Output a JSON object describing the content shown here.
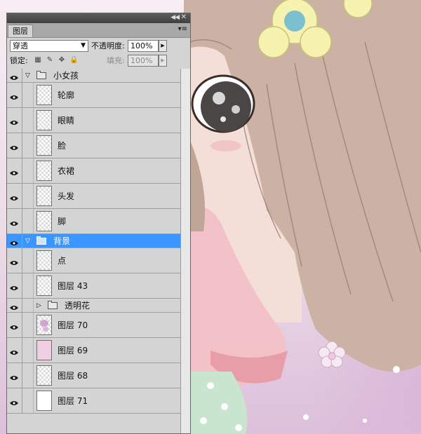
{
  "panel": {
    "tab_label": "图层",
    "blend_mode": "穿透",
    "opacity_label": "不透明度:",
    "opacity_value": "100%",
    "lock_label": "锁定:",
    "fill_label": "填充:",
    "fill_value": "100%"
  },
  "layers": [
    {
      "name": "小女孩",
      "kind": "group",
      "expanded": true,
      "indent": 0,
      "selected": false
    },
    {
      "name": "轮廓",
      "kind": "layer",
      "indent": 1,
      "thumb": "transparent",
      "selected": false
    },
    {
      "name": "眼睛",
      "kind": "layer",
      "indent": 1,
      "thumb": "transparent",
      "selected": false
    },
    {
      "name": "脸",
      "kind": "layer",
      "indent": 1,
      "thumb": "transparent",
      "selected": false
    },
    {
      "name": "衣裙",
      "kind": "layer",
      "indent": 1,
      "thumb": "transparent",
      "selected": false
    },
    {
      "name": "头发",
      "kind": "layer",
      "indent": 1,
      "thumb": "transparent",
      "selected": false
    },
    {
      "name": "脚",
      "kind": "layer",
      "indent": 1,
      "thumb": "transparent",
      "selected": false
    },
    {
      "name": "背景",
      "kind": "group",
      "expanded": true,
      "indent": 0,
      "selected": true
    },
    {
      "name": "点",
      "kind": "layer",
      "indent": 1,
      "thumb": "transparent",
      "selected": false
    },
    {
      "name": "图层 43",
      "kind": "layer",
      "indent": 1,
      "thumb": "transparent",
      "selected": false
    },
    {
      "name": "透明花",
      "kind": "group",
      "expanded": false,
      "indent": 1,
      "selected": false
    },
    {
      "name": "图层 70",
      "kind": "layer",
      "indent": 1,
      "thumb": "purple",
      "selected": false
    },
    {
      "name": "图层 69",
      "kind": "layer",
      "indent": 1,
      "thumb": "pink",
      "selected": false
    },
    {
      "name": "图层 68",
      "kind": "layer",
      "indent": 1,
      "thumb": "transparent",
      "selected": false
    },
    {
      "name": "图层 71",
      "kind": "layer",
      "indent": 1,
      "thumb": "white",
      "selected": false
    }
  ],
  "colors": {
    "selection": "#3c96ff",
    "panel_bg": "#d4d4d4"
  }
}
